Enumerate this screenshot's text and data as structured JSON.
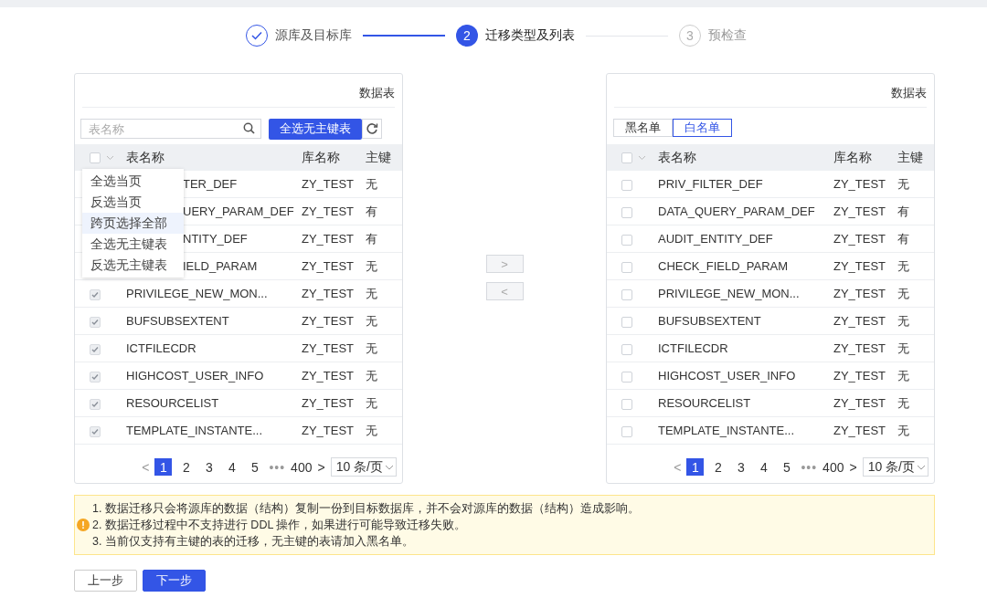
{
  "steps": [
    {
      "label": "源库及目标库",
      "completed": true,
      "current": false
    },
    {
      "number": "2",
      "label": "迁移类型及列表",
      "completed": false,
      "current": true
    },
    {
      "number": "3",
      "label": "预检查",
      "completed": false,
      "current": false
    }
  ],
  "source_panel": {
    "title": "数据表",
    "search": {
      "placeholder": "表名称"
    },
    "select_button": "全选无主键表",
    "select_all": {
      "checked": false
    },
    "columns": [
      "表名称",
      "库名称",
      "主键"
    ],
    "menu": [
      {
        "label": "全选当页",
        "selected": false
      },
      {
        "label": "反选当页",
        "selected": false
      },
      {
        "label": "跨页选择全部",
        "selected": true
      },
      {
        "label": "全选无主键表",
        "selected": false
      },
      {
        "label": "反选无主键表",
        "selected": false
      }
    ],
    "rows": [
      {
        "kind": "covered",
        "name": "TER_DEF",
        "db": "ZY_TEST",
        "pk": "无"
      },
      {
        "kind": "covered",
        "name": "UERY_PARAM_DEF",
        "db": "ZY_TEST",
        "pk": "有"
      },
      {
        "kind": "covered",
        "name": "NTITY_DEF",
        "db": "ZY_TEST",
        "pk": "有"
      },
      {
        "kind": "covered",
        "name": "IELD_PARAM",
        "db": "ZY_TEST",
        "pk": "无"
      },
      {
        "kind": "normal",
        "name": "PRIVILEGE_NEW_MON...",
        "db": "ZY_TEST",
        "pk": "无",
        "checked": true,
        "disabled": true
      },
      {
        "kind": "normal",
        "name": "BUFSUBSEXTENT",
        "db": "ZY_TEST",
        "pk": "无",
        "checked": true,
        "disabled": true
      },
      {
        "kind": "normal",
        "name": "ICTFILECDR",
        "db": "ZY_TEST",
        "pk": "无",
        "checked": true,
        "disabled": true
      },
      {
        "kind": "normal",
        "name": "HIGHCOST_USER_INFO",
        "db": "ZY_TEST",
        "pk": "无",
        "checked": true,
        "disabled": true
      },
      {
        "kind": "normal",
        "name": "RESOURCELIST",
        "db": "ZY_TEST",
        "pk": "无",
        "checked": true,
        "disabled": true
      },
      {
        "kind": "normal",
        "name": "TEMPLATE_INSTANTE...",
        "db": "ZY_TEST",
        "pk": "无",
        "checked": true,
        "disabled": true
      }
    ],
    "pagination": {
      "prev": "<",
      "pages": [
        {
          "label": "1",
          "selected": true
        },
        {
          "label": "2",
          "selected": false
        },
        {
          "label": "3",
          "selected": false
        },
        {
          "label": "4",
          "selected": false
        },
        {
          "label": "5",
          "selected": false
        }
      ],
      "ellipsis": "•••",
      "last": "400",
      "next": ">",
      "page_size": "10 条/页"
    }
  },
  "move_buttons": [
    ">",
    "<"
  ],
  "target_panel": {
    "title": "数据表",
    "tabs": [
      {
        "label": "黑名单",
        "selected": false
      },
      {
        "label": "白名单",
        "selected": true
      }
    ],
    "select_all": {
      "checked": false
    },
    "columns": [
      "表名称",
      "库名称",
      "主键"
    ],
    "rows": [
      {
        "kind": "normal",
        "name": "PRIV_FILTER_DEF",
        "db": "ZY_TEST",
        "pk": "无",
        "checked": false,
        "disabled": false
      },
      {
        "kind": "normal",
        "name": "DATA_QUERY_PARAM_DEF",
        "db": "ZY_TEST",
        "pk": "有",
        "checked": false,
        "disabled": false
      },
      {
        "kind": "normal",
        "name": "AUDIT_ENTITY_DEF",
        "db": "ZY_TEST",
        "pk": "有",
        "checked": false,
        "disabled": false
      },
      {
        "kind": "normal",
        "name": "CHECK_FIELD_PARAM",
        "db": "ZY_TEST",
        "pk": "无",
        "checked": false,
        "disabled": false
      },
      {
        "kind": "normal",
        "name": "PRIVILEGE_NEW_MON...",
        "db": "ZY_TEST",
        "pk": "无",
        "checked": false,
        "disabled": false
      },
      {
        "kind": "normal",
        "name": "BUFSUBSEXTENT",
        "db": "ZY_TEST",
        "pk": "无",
        "checked": false,
        "disabled": false
      },
      {
        "kind": "normal",
        "name": "ICTFILECDR",
        "db": "ZY_TEST",
        "pk": "无",
        "checked": false,
        "disabled": false
      },
      {
        "kind": "normal",
        "name": "HIGHCOST_USER_INFO",
        "db": "ZY_TEST",
        "pk": "无",
        "checked": false,
        "disabled": false
      },
      {
        "kind": "normal",
        "name": "RESOURCELIST",
        "db": "ZY_TEST",
        "pk": "无",
        "checked": false,
        "disabled": false
      },
      {
        "kind": "normal",
        "name": "TEMPLATE_INSTANTE...",
        "db": "ZY_TEST",
        "pk": "无",
        "checked": false,
        "disabled": false
      }
    ],
    "pagination": {
      "prev": "<",
      "pages": [
        {
          "label": "1",
          "selected": true
        },
        {
          "label": "2",
          "selected": false
        },
        {
          "label": "3",
          "selected": false
        },
        {
          "label": "4",
          "selected": false
        },
        {
          "label": "5",
          "selected": false
        }
      ],
      "ellipsis": "•••",
      "last": "400",
      "next": ">",
      "page_size": "10 条/页"
    }
  },
  "notice": [
    "1. 数据迁移只会将源库的数据（结构）复制一份到目标数据库，并不会对源库的数据（结构）造成影响。",
    "2. 数据迁移过程中不支持进行 DDL 操作，如果进行可能导致迁移失败。",
    "3. 当前仅支持有主键的表的迁移，无主键的表请加入黑名单。"
  ],
  "buttons": [
    {
      "label": "上一步",
      "kind": "default"
    },
    {
      "label": "下一步",
      "kind": "primary"
    }
  ]
}
